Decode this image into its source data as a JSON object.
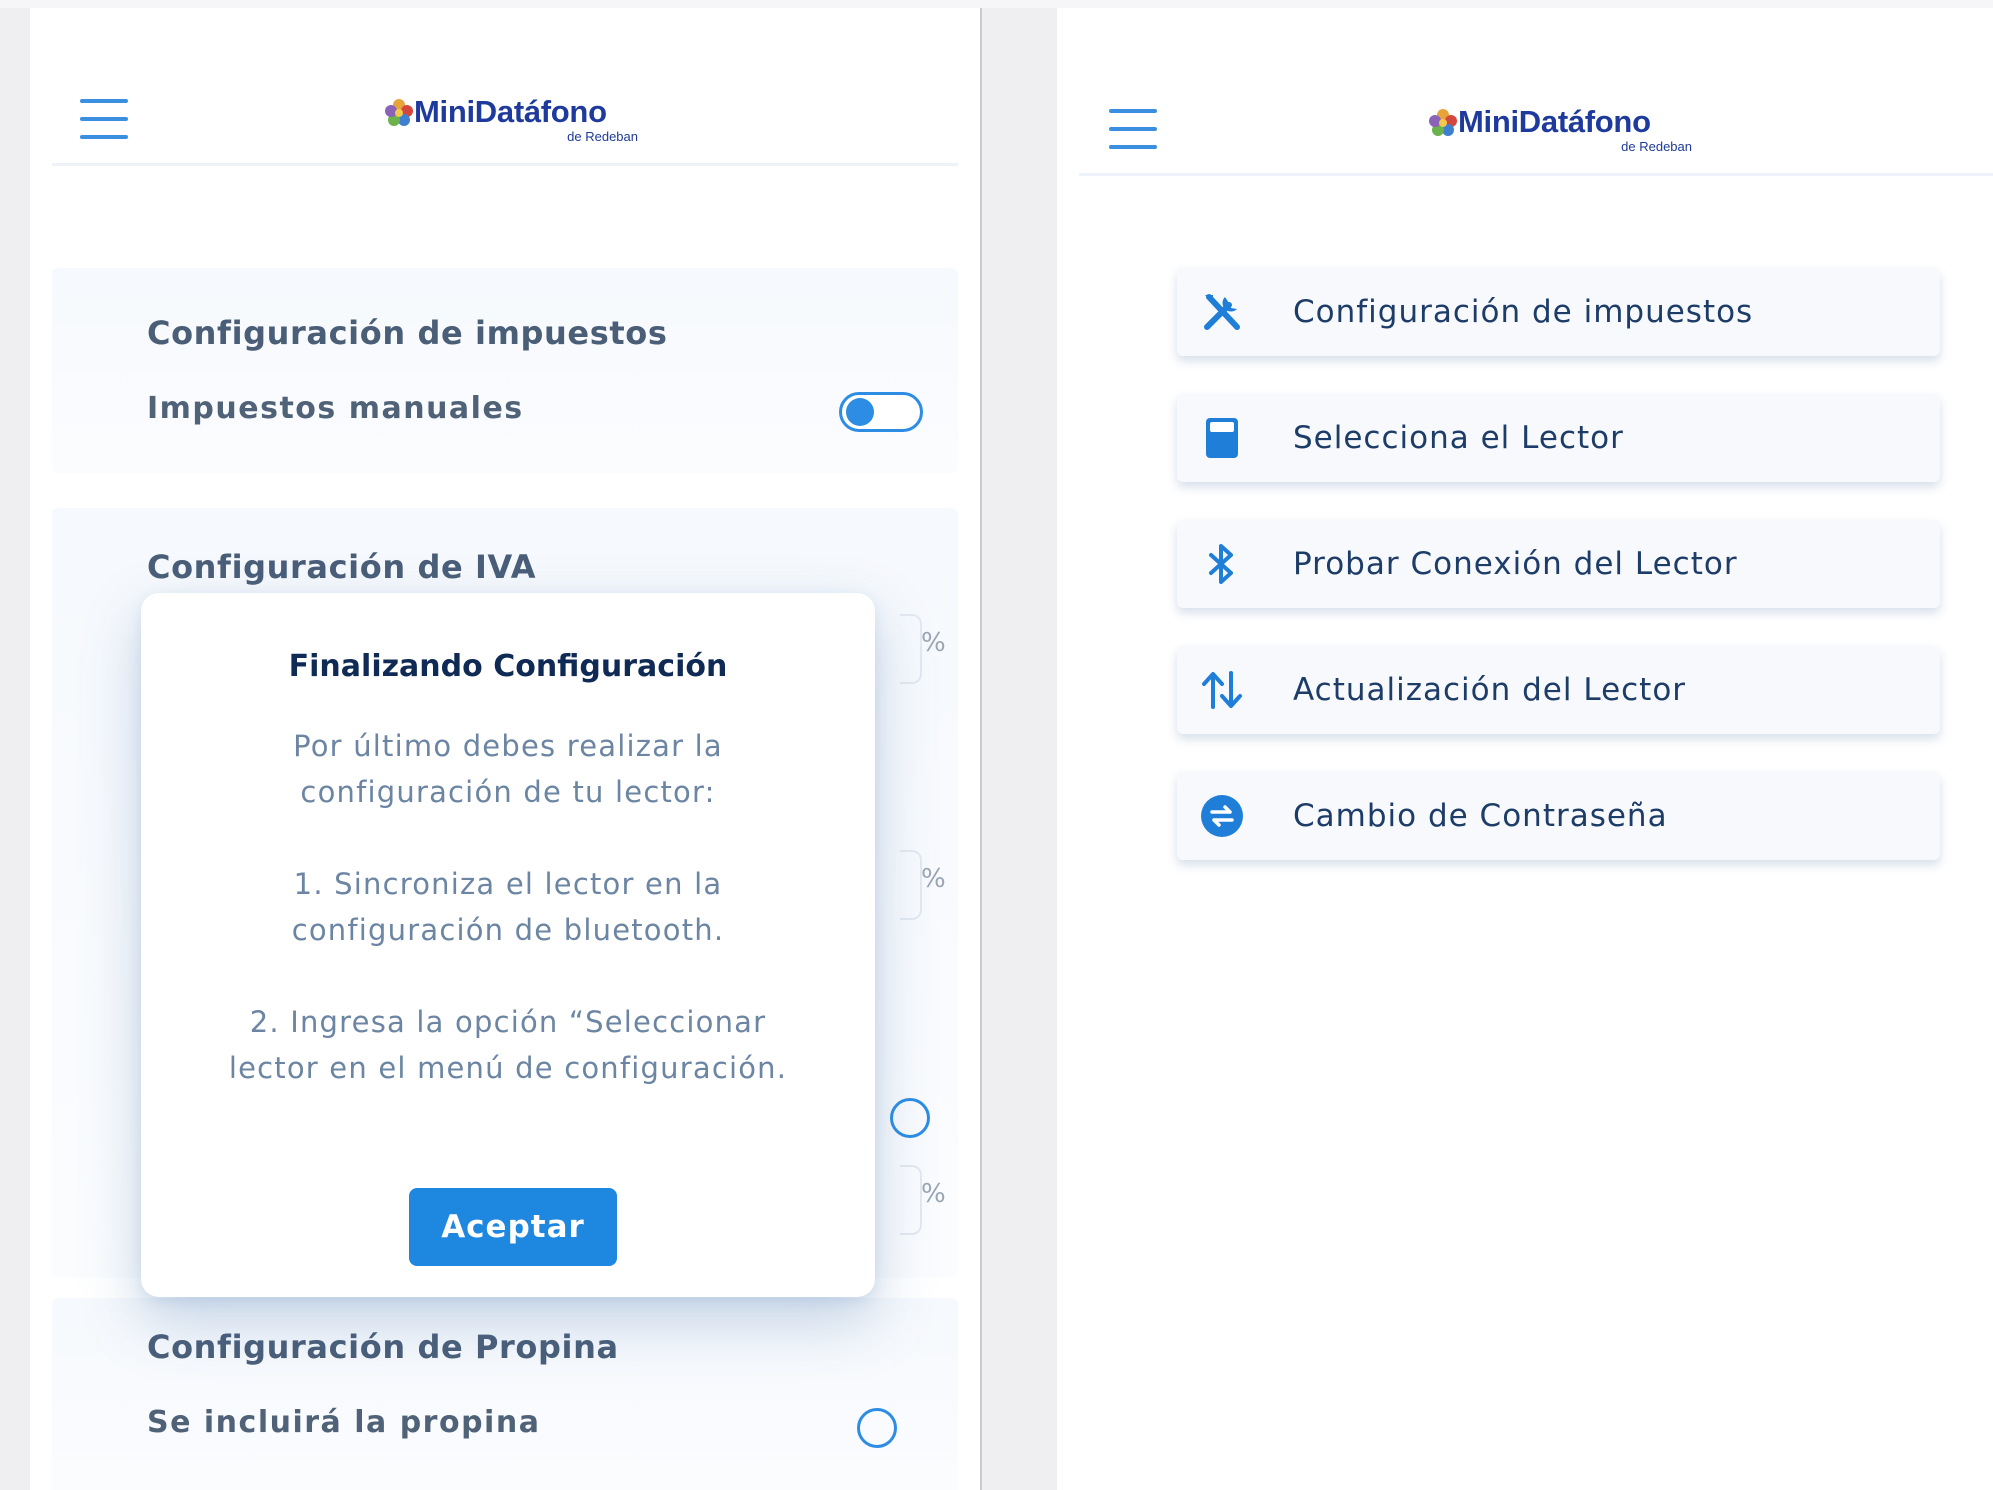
{
  "left_screen": {
    "header": {
      "logo_name": "MiniDatáfono",
      "logo_sub": "de Redeban"
    },
    "tax_section": {
      "title": "Configuración de impuestos",
      "manual_label": "Impuestos manuales",
      "manual_enabled": false
    },
    "iva_section": {
      "title": "Configuración de IVA",
      "unit": "%"
    },
    "tip_section": {
      "title": "Configuración de Propina",
      "include_label": "Se incluirá la propina"
    },
    "modal": {
      "title": "Finalizando Configuración",
      "intro_line1": "Por último debes realizar la",
      "intro_line2": "configuración de tu lector:",
      "step1_line1": "1. Sincroniza el lector en la",
      "step1_line2": "configuración de bluetooth.",
      "step2_line1": "2. Ingresa la opción “Seleccionar",
      "step2_line2": "lector en el menú de configuración.",
      "accept_label": "Aceptar"
    }
  },
  "right_screen": {
    "header": {
      "logo_name": "MiniDatáfono",
      "logo_sub": "de Redeban"
    },
    "menu": [
      {
        "label": "Configuración de impuestos",
        "icon": "tools-icon"
      },
      {
        "label": "Selecciona el Lector",
        "icon": "card-reader-icon"
      },
      {
        "label": "Probar Conexión del Lector",
        "icon": "bluetooth-icon"
      },
      {
        "label": "Actualización del Lector",
        "icon": "sort-arrows-icon"
      },
      {
        "label": "Cambio de Contraseña",
        "icon": "exchange-icon"
      }
    ]
  },
  "colors": {
    "accent": "#1e87e0",
    "logo": "#1e3a9c",
    "title": "#0f2a54"
  }
}
